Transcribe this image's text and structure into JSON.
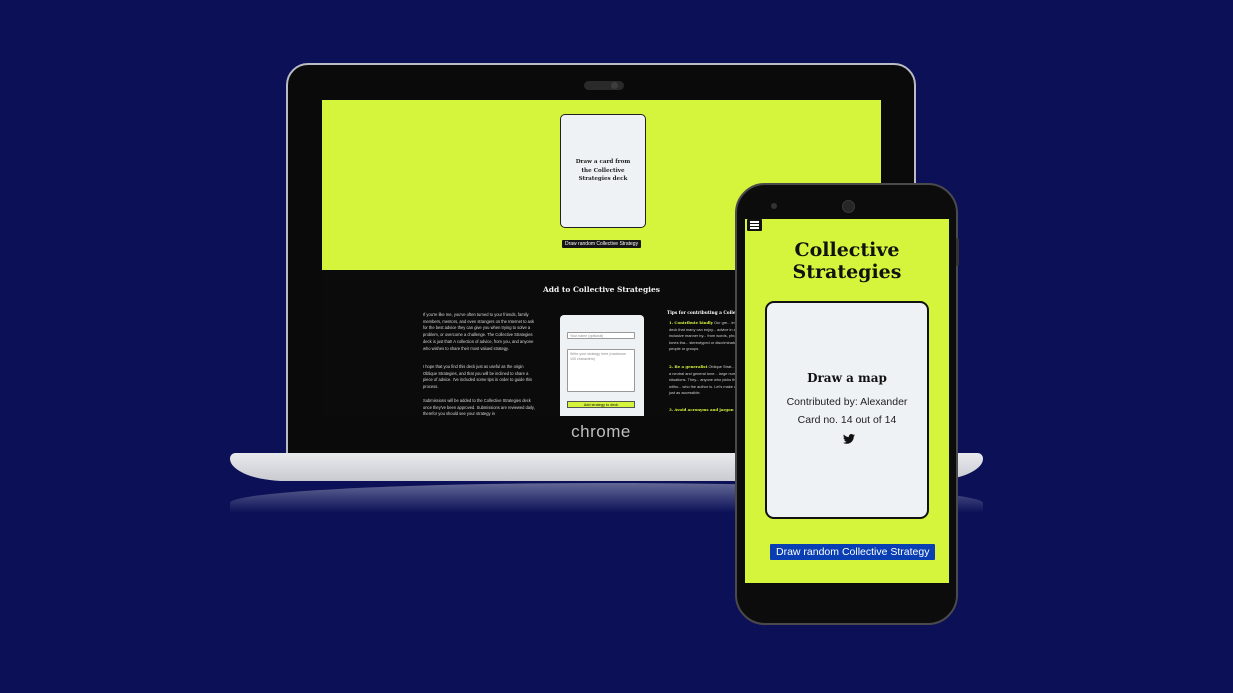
{
  "laptop": {
    "brand": "chrome",
    "hero_card_text": "Draw a card from the Collective Strategies deck",
    "draw_button": "Draw random Collective Strategy",
    "add_heading": "Add to Collective Strategies",
    "paragraphs": [
      "If you're like me, you've often turned to your friends, family members, mentors, and even strangers on the Internet to ask for the best advice they can give you when trying to solve a problem, or overcome a challenge. The Collective Strategies deck is just that! A collection of advice, from you, and anyone who wishes to share their most valued strategy.",
      "I hope that you find this deck just as useful as the origin Oblique Strategies, and that you will be inclined to share a piece of advice. I've included some tips in order to guide this process.",
      "Submissions will be added to the Collective Strategies deck once they've been approved. Submissions are reviewed daily, therefor you should see your strategy in"
    ],
    "form": {
      "name_placeholder": "Your name (optional)",
      "strategy_placeholder": "Write your strategy here (maximum 100 characters)",
      "submit": "Add strategy to deck"
    },
    "tips_heading": "Tips for contributing a Collective Strategy",
    "tips": [
      {
        "label": "1. Contribute kindly",
        "text": "Our gre... impact deck that many can enjoy... advice in an inclusive manner by... from words, phrases or tones tha... stereotyped or discriminatory vie... people or groups."
      },
      {
        "label": "2. Be a generalist",
        "text": "Oblique Strat... having a neutral and general tone... large number of situations. They... anyone who picks them up, witho... who the author is. Let's make our... just as accessible."
      },
      {
        "label": "3. Avoid acronyms and jargon",
        "text": ""
      }
    ]
  },
  "phone": {
    "title": "Collective Strategies",
    "card": {
      "title": "Draw a map",
      "contributor": "Contributed by: Alexander",
      "count": "Card no. 14 out of 14"
    },
    "draw_button": "Draw random Collective Strategy"
  },
  "colors": {
    "background": "#0b1057",
    "lime": "#d4f53c",
    "button_blue": "#0a3fb3"
  }
}
